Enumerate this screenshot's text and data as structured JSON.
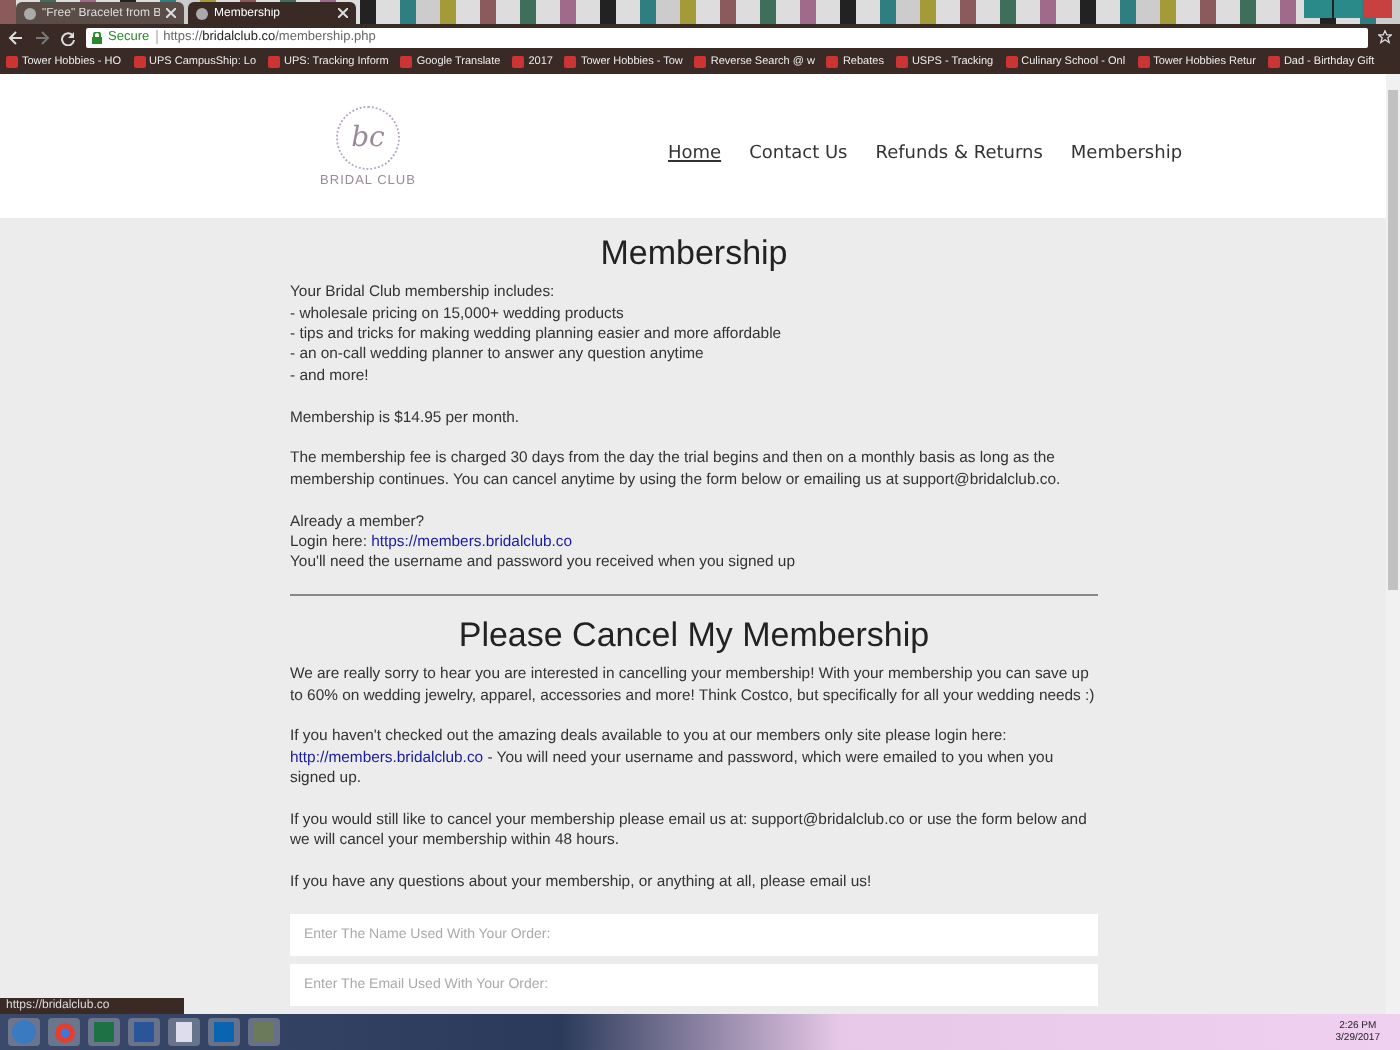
{
  "browser": {
    "tabs": [
      {
        "title": "\"Free\" Bracelet from B",
        "selected": false
      },
      {
        "title": "Membership",
        "selected": true
      }
    ],
    "address": {
      "secure_label": "Secure",
      "url_scheme": "https://",
      "url_host": "bridalclub.co",
      "url_path": "/membership.php"
    },
    "bookmarks": [
      "Tower Hobbies - HO",
      "UPS CampusShip: Lo",
      "UPS: Tracking Inform",
      "Google Translate",
      "2017",
      "Tower Hobbies - Tow",
      "Reverse Search @ w",
      "Rebates",
      "USPS - Tracking",
      "Culinary School - Onl",
      "Tower Hobbies Retur",
      "Dad - Birthday Gift"
    ],
    "status_url": "https://bridalclub.co"
  },
  "site": {
    "logo_monogram": "bc",
    "logo_name": "BRIDAL CLUB",
    "nav": [
      {
        "label": "Home",
        "selected": true
      },
      {
        "label": "Contact Us",
        "selected": false
      },
      {
        "label": "Refunds & Returns",
        "selected": false
      },
      {
        "label": "Membership",
        "selected": false
      }
    ]
  },
  "sections": [
    {
      "title": "Membership",
      "paragraphs": [
        [
          [
            {
              "kind": "text",
              "text": "Your Bridal Club membership includes:"
            }
          ],
          [
            {
              "kind": "text",
              "text": "- wholesale pricing on 15,000+ wedding products"
            }
          ],
          [
            {
              "kind": "text",
              "text": "- tips and tricks for making wedding planning easier and more affordable"
            }
          ],
          [
            {
              "kind": "text",
              "text": "- an on-call wedding planner to answer any question anytime"
            }
          ],
          [
            {
              "kind": "text",
              "text": "- and more!"
            }
          ]
        ],
        [
          [
            {
              "kind": "text",
              "text": "Membership is $14.95 per month."
            }
          ]
        ],
        [
          [
            {
              "kind": "text",
              "text": "The membership fee is charged 30 days from the day the trial begins and then on a monthly basis as long as the membership continues. You can cancel anytime by using the form below or emailing us at support@bridalclub.co."
            }
          ]
        ],
        [
          [
            {
              "kind": "text",
              "text": "Already a member?"
            }
          ],
          [
            {
              "kind": "text",
              "text": "Login here: "
            },
            {
              "kind": "link",
              "text": "https://members.bridalclub.co"
            }
          ],
          [
            {
              "kind": "text",
              "text": "You'll need the username and password you received when you signed up"
            }
          ]
        ]
      ]
    },
    {
      "title": "Please Cancel My Membership",
      "paragraphs": [
        [
          [
            {
              "kind": "text",
              "text": "We are really sorry to hear you are interested in cancelling your membership! With your membership you can save up to 60% on wedding jewelry, apparel, accessories and more! Think Costco, but specifically for all your wedding needs :)"
            }
          ]
        ],
        [
          [
            {
              "kind": "text",
              "text": "If you haven't checked out the amazing deals available to you at our members only site please login here: "
            },
            {
              "kind": "link",
              "text": "http://members.bridalclub.co"
            },
            {
              "kind": "text",
              "text": " - You will need your username and password, which were emailed to you when you signed up."
            }
          ]
        ],
        [
          [
            {
              "kind": "text",
              "text": "If you would still like to cancel your membership please email us at: support@bridalclub.co or use the form below and we will cancel your membership within 48 hours."
            }
          ]
        ],
        [
          [
            {
              "kind": "text",
              "text": "If you have any questions about your membership, or anything at all, please email us!"
            }
          ]
        ]
      ],
      "fields": [
        {
          "placeholder": "Enter The Name Used With Your Order:"
        },
        {
          "placeholder": "Enter The Email Used With Your Order:"
        }
      ]
    }
  ],
  "taskbar": {
    "time": "2:26 PM",
    "date": "3/29/2017"
  }
}
